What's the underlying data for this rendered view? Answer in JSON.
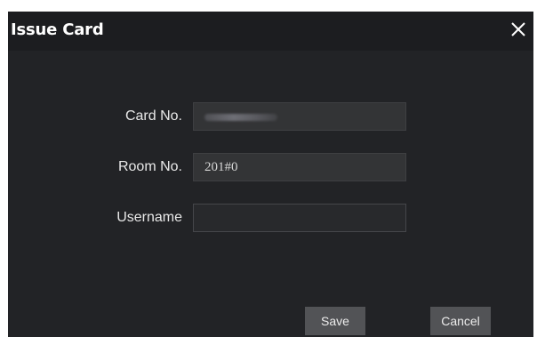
{
  "dialog": {
    "title": "Issue Card",
    "close_icon": "close-icon"
  },
  "form": {
    "card_no": {
      "label": "Card No.",
      "value": ""
    },
    "room_no": {
      "label": "Room No.",
      "value": "201#0"
    },
    "username": {
      "label": "Username",
      "value": ""
    }
  },
  "buttons": {
    "save_label": "Save",
    "cancel_label": "Cancel"
  },
  "colors": {
    "dialog_bg": "#222326",
    "field_bg": "#333436",
    "button_bg": "#525356",
    "text": "#ffffff"
  }
}
